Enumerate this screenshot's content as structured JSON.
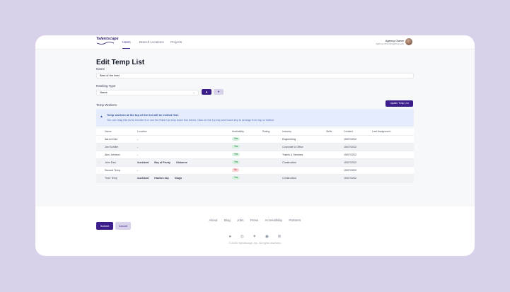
{
  "nav": {
    "logo": "Talentscape",
    "links": [
      "Users",
      "Branch Locations",
      "Projects"
    ],
    "user_name": "Agency Owner",
    "user_email": "agency.owner@agency.com"
  },
  "page": {
    "title": "Edit Temp List",
    "name_label": "Name",
    "name_value": "Best of the best",
    "ranking_label": "Ranking Type",
    "ranking_value": "Name",
    "up_glyph": "▲",
    "down_glyph": "▼",
    "temp_workers_label": "Temp Workers",
    "update_button": "Update Temp List",
    "info_title": "Temp workers at the top of the list will be invited first.",
    "info_body": "You can drag this list to reorder it or use the Rank Up drop down box below. Click on the Up key and Down key to arrange from top or bottom."
  },
  "table": {
    "headers": [
      "",
      "Name",
      "Location",
      "Availability",
      "Rating",
      "Industry",
      "Skills",
      "Created",
      "Last Assignment"
    ],
    "rows": [
      {
        "name": "Aaron Kidd",
        "loc1": "-",
        "loc2": "",
        "loc3": "",
        "avail": "Yes",
        "industry": "Engineering",
        "created": "15/07/2022"
      },
      {
        "name": "Joel Schiller",
        "loc1": "-",
        "loc2": "",
        "loc3": "",
        "avail": "Yes",
        "industry": "Corporate & Office",
        "created": "15/07/2022"
      },
      {
        "name": "Alex Johnson",
        "loc1": "-",
        "loc2": "",
        "loc3": "",
        "avail": "Yes",
        "industry": "Trades & Services",
        "created": "15/07/2022"
      },
      {
        "name": "John Paul",
        "loc1": "Auckland",
        "loc2": "Bay of Plenty",
        "loc3": "Gisborne",
        "avail": "Yes",
        "industry": "Construction",
        "created": "15/07/2022"
      },
      {
        "name": "Second Temp",
        "loc1": "-",
        "loc2": "",
        "loc3": "",
        "avail": "No",
        "industry": "",
        "created": "15/07/2022"
      },
      {
        "name": "Third Temp",
        "loc1": "Auckland",
        "loc2": "Hawkes bay",
        "loc3": "Otago",
        "avail": "Yes",
        "industry": "Construction",
        "created": "15/07/2022"
      }
    ]
  },
  "actions": {
    "submit": "Submit",
    "cancel": "Cancel"
  },
  "footer": {
    "links": [
      "About",
      "Blog",
      "Jobs",
      "Press",
      "Accessibility",
      "Partners"
    ],
    "social_icons": [
      "facebook-icon",
      "instagram-icon",
      "twitter-icon",
      "github-icon",
      "dribbble-icon"
    ],
    "copyright": "© 2020 Talentscape, Inc. All rights reserved."
  }
}
